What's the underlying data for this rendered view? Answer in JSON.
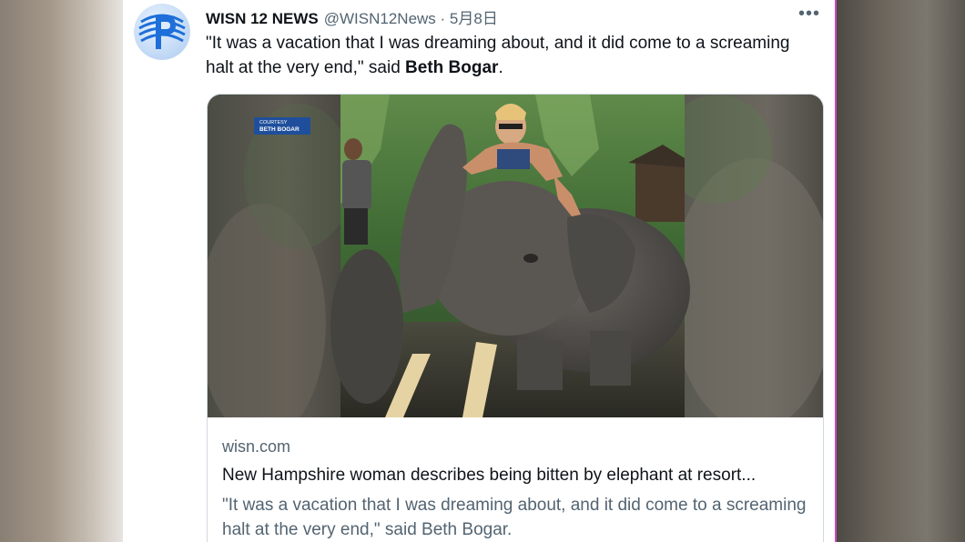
{
  "tweet": {
    "author_name": "WISN 12 NEWS",
    "handle": "@WISN12News",
    "date": "· 5月8日",
    "more_label": "•••",
    "text_quote": "\"It was a vacation that I was dreaming about, and it did come to a screaming halt at the very end,\" said",
    "text_name": "Beth Bogar",
    "text_end": "."
  },
  "link_card": {
    "photo_credit_line1": "COURTESY",
    "photo_credit_line2": "BETH BOGAR",
    "domain": "wisn.com",
    "title": "New Hampshire woman describes being bitten by elephant at resort...",
    "description": "\"It was a vacation that I was dreaming about, and it did come to a screaming halt at the very end,\" said Beth Bogar."
  },
  "colors": {
    "card_bg": "#ffffff",
    "text_primary": "#0f1419",
    "text_secondary": "#536471",
    "avatar_blue": "#1e6fd9",
    "credit_badge": "#1f4f9c",
    "border": "#cfd9de"
  }
}
